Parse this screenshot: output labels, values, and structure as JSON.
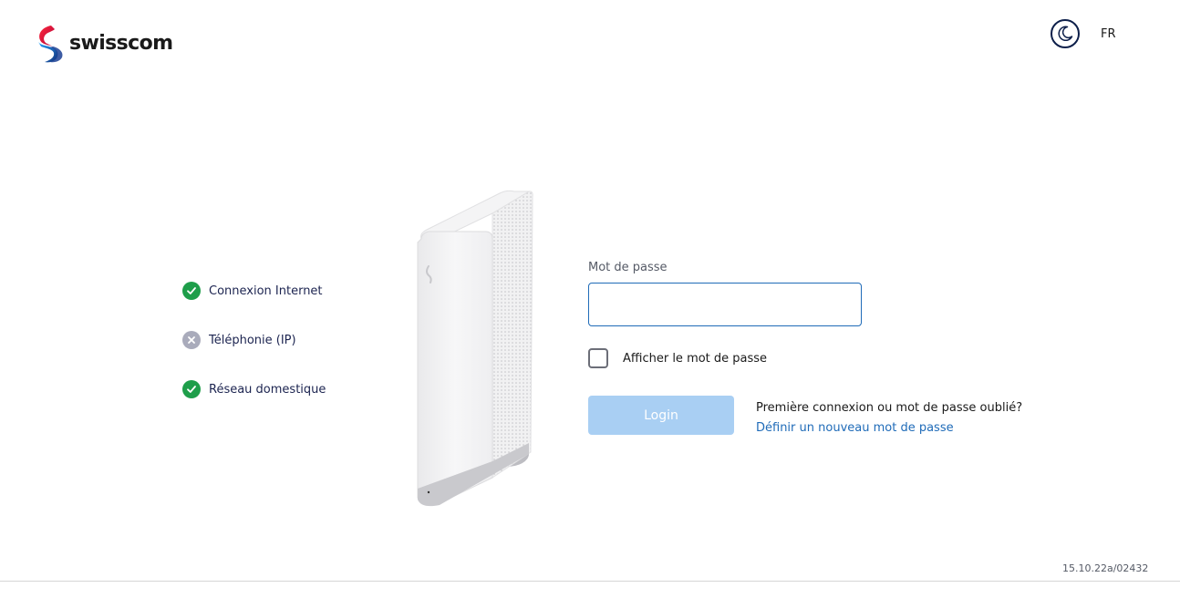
{
  "header": {
    "logo_text": "swisscom",
    "theme_icon": "moon-icon",
    "language": "FR"
  },
  "status": {
    "items": [
      {
        "label": "Connexion Internet",
        "state": "ok",
        "icon": "check-icon"
      },
      {
        "label": "Téléphonie (IP)",
        "state": "off",
        "icon": "cross-icon"
      },
      {
        "label": "Réseau domestique",
        "state": "ok",
        "icon": "check-icon"
      }
    ]
  },
  "form": {
    "password_label": "Mot de passe",
    "password_value": "",
    "show_password_label": "Afficher le mot de passe",
    "login_label": "Login",
    "help_text": "Première connexion ou mot de passe oublié?",
    "help_link": "Définir un nouveau mot de passe"
  },
  "footer": {
    "version": "15.10.22a/02432"
  },
  "colors": {
    "brand_blue": "#1f6bb8",
    "ok_green": "#1e9e4a",
    "off_grey": "#a9abbb",
    "login_disabled": "#a9cff3",
    "logo_red": "#e4002b",
    "logo_blue": "#1b3f94"
  }
}
